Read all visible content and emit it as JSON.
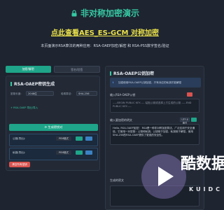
{
  "header": {
    "title": "非对称加密演示",
    "subtitle": "点此查看AES_ES-GCM 对称加密",
    "description": "本页面演示RSA算法的两种应用：RSA-OAEP加密/解密 和 RSA-PSS数字签名/验证"
  },
  "tabs": [
    {
      "label": "加密/解密",
      "active": true
    },
    {
      "label": "签名/验签",
      "active": false
    }
  ],
  "keygen": {
    "section_title": "RSA-OAEP密钥生成",
    "key_length_label": "密钥长度:",
    "key_length_value": "2048位",
    "hash_label": "哈希算法:",
    "hash_value": "SHA-256",
    "import_link": "+ RSA-OAEP 导出/导入",
    "generate_button": "生成密钥对",
    "public_key_label": "公钥(导出):",
    "public_key_format": "PEM格式",
    "private_key_label": "私钥(导出):",
    "private_key_format": "PEM格式",
    "clear_button": "清空所有密钥"
  },
  "encrypt": {
    "section_title": "RSA-OAEP公钥加密",
    "notice": "加密使用RSA-OAEP公钥加密，只有对应的私钥才能解密",
    "input_label": "输入RSA-OAEP公钥",
    "input_placeholder": "-----BEGIN PUBLIC KEY----- 粘贴公钥或选择上方生成的公钥 -----END PUBLIC KEY-----",
    "plaintext_label": "输入要加密的明文",
    "plaintext_value": "Hello, RSA-OAEP加密！ RSA是一种非对称加密算法，广泛应用于安全通信。它使用一对密钥：公钥和私钥。公钥用于加密，私钥用于解密。使用SHA-256的RSA-OAEP提供了更强的安全性。",
    "plaintext_format": "UTF-8格式",
    "output_label": "生成的密文"
  },
  "colors": {
    "accent": "#1fa589",
    "title": "#36c9a3",
    "link": "#e8e04a",
    "danger": "#d9534f",
    "background": "#1e2430"
  },
  "watermark": {
    "text": "酷数据",
    "sub": "KUIDC"
  }
}
